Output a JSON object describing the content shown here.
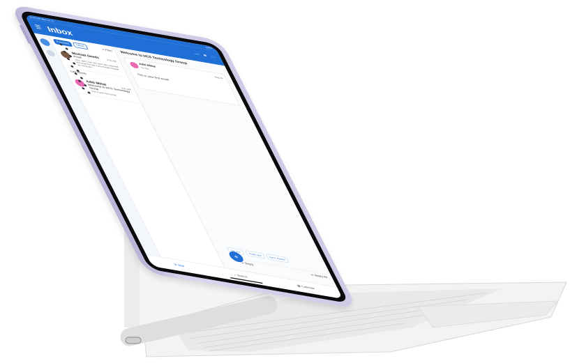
{
  "statusbar": {
    "time": "10:42 AM   Wed Jul 21",
    "right": "100%"
  },
  "app": {
    "title": "Inbox",
    "tabs": {
      "focused": "Focused",
      "other": "Other"
    },
    "filter": "Filter"
  },
  "messages": [
    {
      "sender": "Michael Deeds",
      "time": "9:41 AM",
      "subject": "Proof",
      "preview": "Hey, John how are you? We received the proof for too many things! Please let me know..."
    },
    {
      "sender": "Aditi Mittal",
      "time": "8:02 AM",
      "subject": "Welcome to HCS Technology Group",
      "preview": "This is your first email."
    }
  ],
  "list_section": "Last Month",
  "reading": {
    "subject": "Welcome to HCS Technology Group",
    "card": {
      "sender": "Aditi Mittal",
      "to": "To You",
      "date": "Aug 23",
      "body": "This is your first email."
    },
    "suggestions": [
      "Yes, it is.",
      "Thank you!",
      "Got it, thanks!"
    ],
    "reply": "Reply",
    "reply_all": "Reply All"
  },
  "bottom": {
    "mail": "Mail",
    "search": "Search",
    "calendar": "Calendar"
  },
  "colors": {
    "accent": "#1f6fd6",
    "tablet": "#cfcbe6",
    "keyboard": "#f2f2f2"
  }
}
